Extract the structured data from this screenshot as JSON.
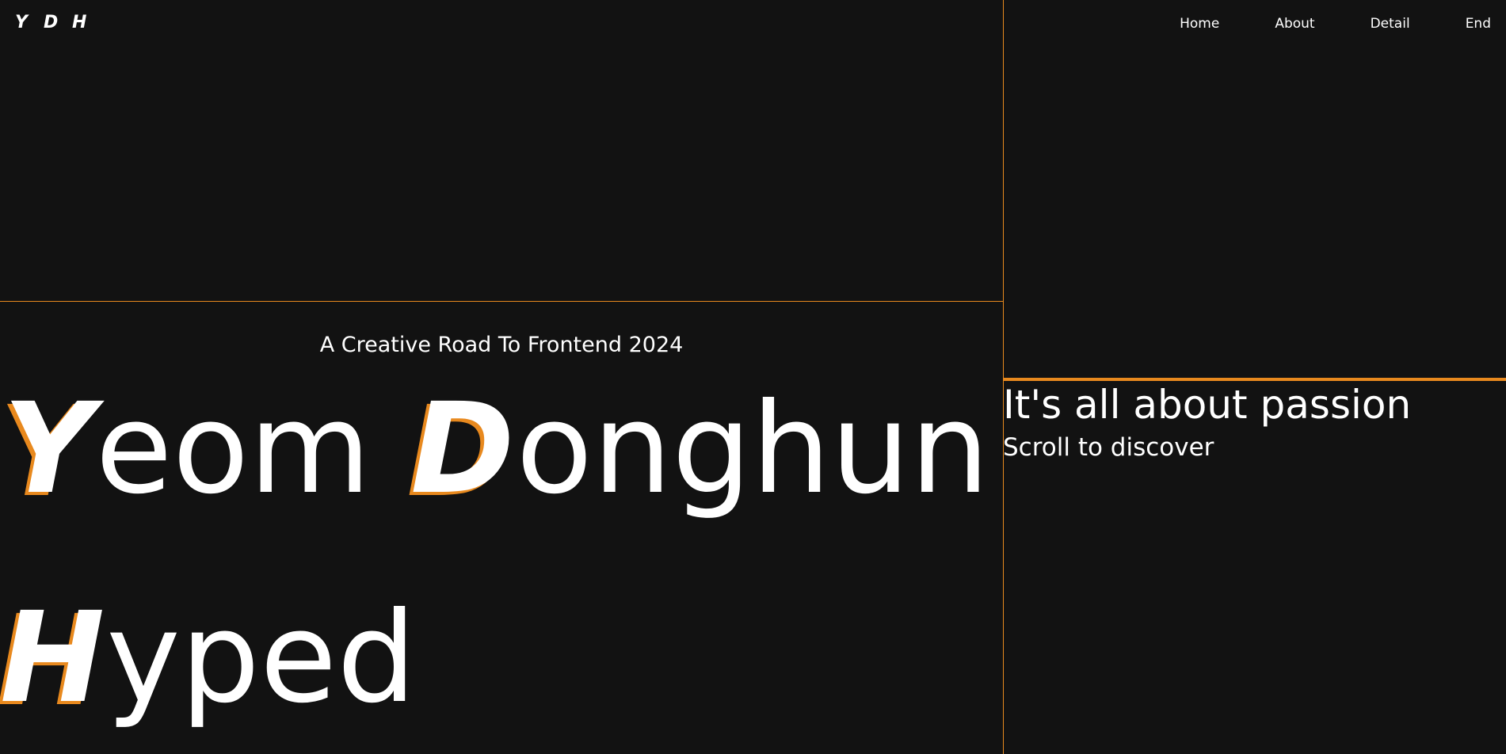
{
  "logo": {
    "letters": [
      "Y",
      "D",
      "H"
    ]
  },
  "nav": {
    "items": [
      {
        "label": "Home"
      },
      {
        "label": "About"
      },
      {
        "label": "Detail"
      },
      {
        "label": "End"
      }
    ]
  },
  "hero": {
    "subtitle": "A Creative Road To Frontend 2024",
    "line1": {
      "word1_cap": "Y",
      "word1_rest": "eom",
      "word2_cap": "D",
      "word2_rest": "onghun"
    },
    "line2": {
      "word_cap": "H",
      "word_rest": "yped"
    }
  },
  "aside": {
    "heading": "It's all about passion",
    "hint": "Scroll to discover"
  },
  "colors": {
    "background": "#121212",
    "accent": "#e8891e",
    "text": "#ffffff"
  }
}
